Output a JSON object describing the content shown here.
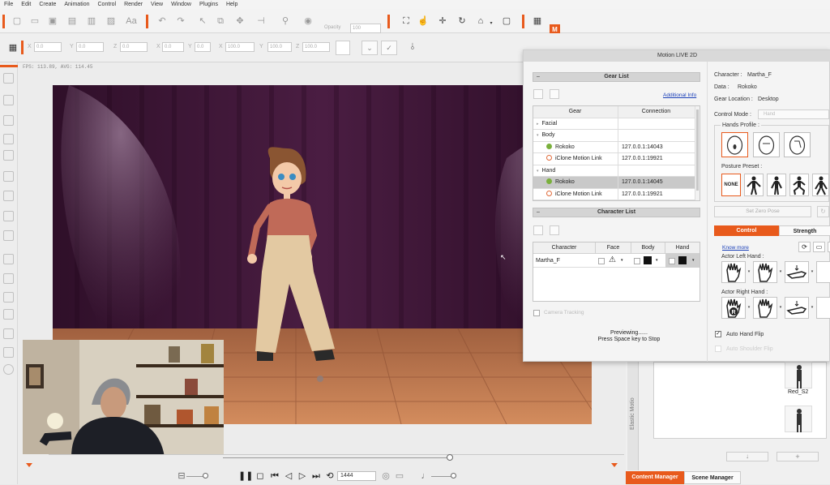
{
  "menu": [
    "File",
    "Edit",
    "Create",
    "Animation",
    "Control",
    "Render",
    "View",
    "Window",
    "Plugins",
    "Help"
  ],
  "toolbar": {
    "opacity_label": "Opacity",
    "opacity_value": "100",
    "transform_fields": [
      {
        "label": "X",
        "value": "0.0"
      },
      {
        "label": "Y",
        "value": "0.0"
      },
      {
        "label": "Z",
        "value": "0.0"
      },
      {
        "label": "X",
        "value": "0.0"
      },
      {
        "label": "Y",
        "value": "0.0"
      },
      {
        "label": "X",
        "value": "100.0"
      },
      {
        "label": "Y",
        "value": "100.0"
      },
      {
        "label": "Z",
        "value": "100.0"
      }
    ]
  },
  "viewport": {
    "fps_text": "FPS: 113.89, AVG: 114.45"
  },
  "timeline": {
    "current_frame": "1444"
  },
  "dialog": {
    "title": "Motion LIVE 2D",
    "gear_list": {
      "header": "Gear List",
      "additional_info": "Additional Info",
      "columns": [
        "Gear",
        "Connection"
      ],
      "rows": [
        {
          "name": "Facial",
          "connection": "",
          "type": "group"
        },
        {
          "name": "Body",
          "connection": "",
          "type": "group"
        },
        {
          "name": "Rokoko",
          "connection": "127.0.0.1:14043",
          "type": "device",
          "status": "connected"
        },
        {
          "name": "iClone Motion Link",
          "connection": "127.0.0.1:19921",
          "type": "device",
          "status": "idle"
        },
        {
          "name": "Hand",
          "connection": "",
          "type": "group"
        },
        {
          "name": "Rokoko",
          "connection": "127.0.0.1:14045",
          "type": "device",
          "status": "connected",
          "selected": true
        },
        {
          "name": "iClone Motion Link",
          "connection": "127.0.0.1:19921",
          "type": "device",
          "status": "idle"
        }
      ]
    },
    "character_list": {
      "header": "Character List",
      "columns": [
        "Character",
        "Face",
        "Body",
        "Hand"
      ],
      "rows": [
        {
          "character": "Martha_F"
        }
      ],
      "camera_tracking": "Camera Tracking"
    },
    "preview": {
      "line1": "Previewing......",
      "line2": "Press Space key to Stop"
    },
    "info": {
      "character_label": "Character :",
      "character_value": "Martha_F",
      "data_label": "Data :",
      "data_value": "Rokoko",
      "gear_location_label": "Gear Location :",
      "gear_location_value": "Desktop",
      "control_mode_label": "Control Mode :",
      "control_mode_value": "Hand"
    },
    "hands_profile_label": "Hands Profile :",
    "posture_preset_label": "Posture Preset :",
    "posture_none": "NONE",
    "set_zero_pose": "Set Zero Pose",
    "tabs": [
      "Control",
      "Strength"
    ],
    "know_more": "Know more",
    "actor_left_hand": "Actor Left Hand :",
    "actor_right_hand": "Actor Right Hand :",
    "auto_hand_flip": "Auto Hand Flip",
    "auto_shoulder_flip": "Auto Shoulder Flip",
    "accent_color": "#e85a1c"
  },
  "content_panel": {
    "side_label": "Elastic Motio",
    "items": [
      {
        "label": "Red_S2"
      }
    ]
  },
  "bottom_tabs": [
    "Content Manager",
    "Scene Manager"
  ]
}
